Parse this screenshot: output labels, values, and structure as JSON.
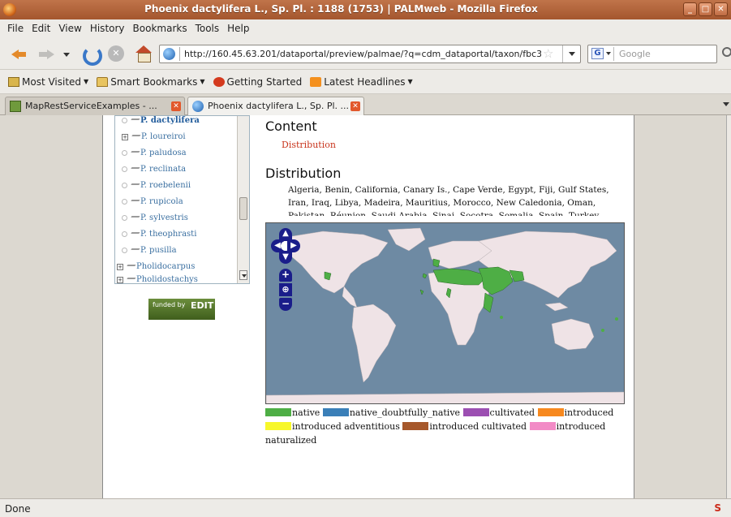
{
  "window": {
    "title": "Phoenix dactylifera L., Sp. Pl. : 1188 (1753) | PALMweb - Mozilla Firefox",
    "minimize_icon": "minimize-icon",
    "maximize_icon": "maximize-icon",
    "close_icon": "close-icon"
  },
  "menubar": {
    "items": [
      "File",
      "Edit",
      "View",
      "History",
      "Bookmarks",
      "Tools",
      "Help"
    ]
  },
  "navbar": {
    "url": "http://160.45.63.201/dataportal/preview/palmae/?q=cdm_dataportal/taxon/fbc3",
    "search_placeholder": "Google",
    "search_engine_letter": "G"
  },
  "bookmarks": {
    "items": [
      "Most Visited",
      "Smart Bookmarks",
      "Getting Started",
      "Latest Headlines"
    ]
  },
  "tabs": {
    "items": [
      {
        "label": "MapRestServiceExamples - ..."
      },
      {
        "label": "Phoenix dactylifera L., Sp. Pl. ..."
      }
    ]
  },
  "tree": {
    "nodes": [
      {
        "name": "P. dactylifera"
      },
      {
        "name": "P. loureiroi"
      },
      {
        "name": "P. paludosa"
      },
      {
        "name": "P. reclinata"
      },
      {
        "name": "P. roebelenii"
      },
      {
        "name": "P. rupicola"
      },
      {
        "name": "P. sylvestris"
      },
      {
        "name": "P. theophrasti"
      },
      {
        "name": "P. pusilla"
      },
      {
        "name": "Pholidocarpus"
      },
      {
        "name": "Pholidostachys"
      }
    ]
  },
  "funded": {
    "label": "funded by",
    "logo": "EDIT"
  },
  "content": {
    "heading": "Content",
    "link": "Distribution",
    "distribution_heading": "Distribution",
    "distribution_text": "Algeria, Benin, California, Canary Is., Cape Verde, Egypt, Fiji, Gulf States, Iran, Iraq, Libya, Madeira, Mauritius, Morocco, New Caledonia, Oman, Pakistan, Réunion, Saudi Arabia, Sinai, Socotra, Somalia, Spain, Turkey"
  },
  "legend": {
    "items": [
      {
        "label": "native",
        "color": "#4eae45"
      },
      {
        "label": "native_doubtfully_native",
        "color": "#3a7fb8"
      },
      {
        "label": "cultivated",
        "color": "#9c4fb2"
      },
      {
        "label": "introduced",
        "color": "#f7891f"
      },
      {
        "label": "introduced adventitious",
        "color": "#f7f72a"
      },
      {
        "label": "introduced cultivated",
        "color": "#a6582b"
      },
      {
        "label": "introduced",
        "color": "#f28bc6"
      }
    ],
    "trailing": "naturalized"
  },
  "status": {
    "text": "Done"
  }
}
